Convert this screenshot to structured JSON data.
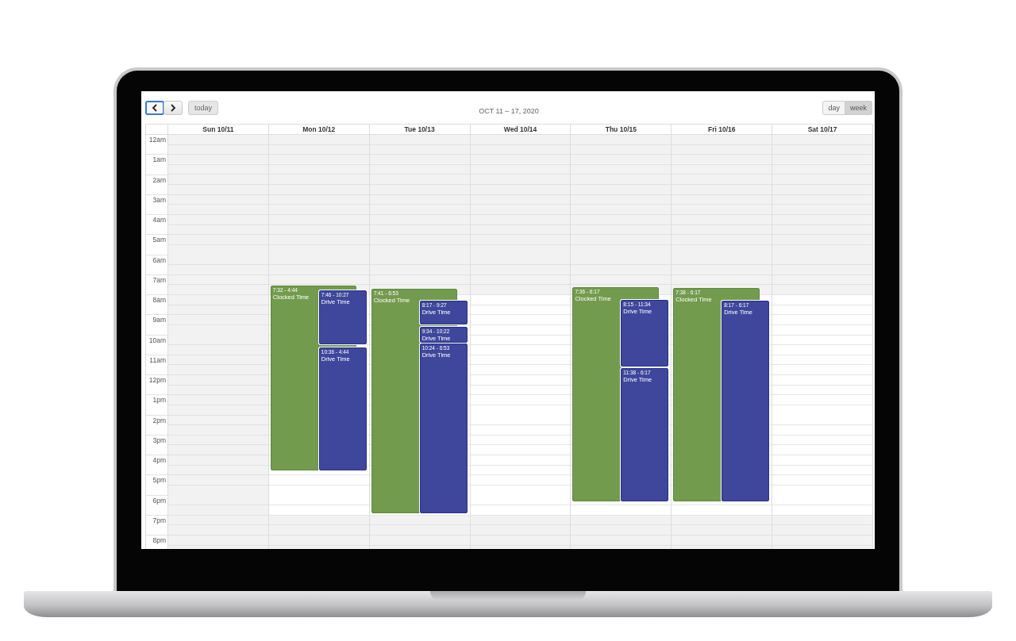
{
  "toolbar": {
    "nav_buttons": [
      {
        "kind": "prev",
        "selected": true
      },
      {
        "kind": "next",
        "selected": false
      }
    ],
    "today": {
      "label": "today",
      "disabled": true
    },
    "title": "OCT 11 – 17, 2020",
    "views": [
      {
        "label": "day",
        "selected": false
      },
      {
        "label": "week",
        "selected": true
      }
    ]
  },
  "hours": [
    "12am",
    "1am",
    "2am",
    "3am",
    "4am",
    "5am",
    "6am",
    "7am",
    "8am",
    "9am",
    "10am",
    "11am",
    "12pm",
    "1pm",
    "2pm",
    "3pm",
    "4pm",
    "5pm",
    "6pm",
    "7pm",
    "8pm"
  ],
  "days": [
    {
      "label": "Sun 10/11",
      "business_hours": false
    },
    {
      "label": "Mon 10/12",
      "business_hours": true,
      "events": [
        {
          "kind": "clocked",
          "time": "7:32 - 4:44",
          "title": "Clocked Time"
        },
        {
          "kind": "drive",
          "time": "7:46 - 10:27",
          "title": "Drive Time"
        },
        {
          "kind": "drive",
          "time": "10:36 - 4:44",
          "title": "Drive Time"
        }
      ]
    },
    {
      "label": "Tue 10/13",
      "business_hours": true,
      "events": [
        {
          "kind": "clocked",
          "time": "7:41 - 6:53",
          "title": "Clocked Time"
        },
        {
          "kind": "drive",
          "time": "8:17 - 9:27",
          "title": "Drive Time"
        },
        {
          "kind": "drive",
          "time": "9:34 - 10:22",
          "title": "Drive Time"
        },
        {
          "kind": "drive",
          "time": "10:24 - 6:53",
          "title": "Drive Time"
        }
      ]
    },
    {
      "label": "Wed 10/14",
      "business_hours": true
    },
    {
      "label": "Thu 10/15",
      "business_hours": true,
      "events": [
        {
          "kind": "clocked",
          "time": "7:36 - 6:17",
          "title": "Clocked Time"
        },
        {
          "kind": "drive",
          "time": "8:15 - 11:34",
          "title": "Drive Time"
        },
        {
          "kind": "drive",
          "time": "11:38 - 6:17",
          "title": "Drive Time"
        }
      ]
    },
    {
      "label": "Fri 10/16",
      "business_hours": true,
      "events": [
        {
          "kind": "clocked",
          "time": "7:38 - 6:17",
          "title": "Clocked Time"
        },
        {
          "kind": "drive",
          "time": "8:17 - 6:17",
          "title": "Drive Time"
        }
      ]
    },
    {
      "label": "Sat 10/17",
      "business_hours": true
    }
  ]
}
